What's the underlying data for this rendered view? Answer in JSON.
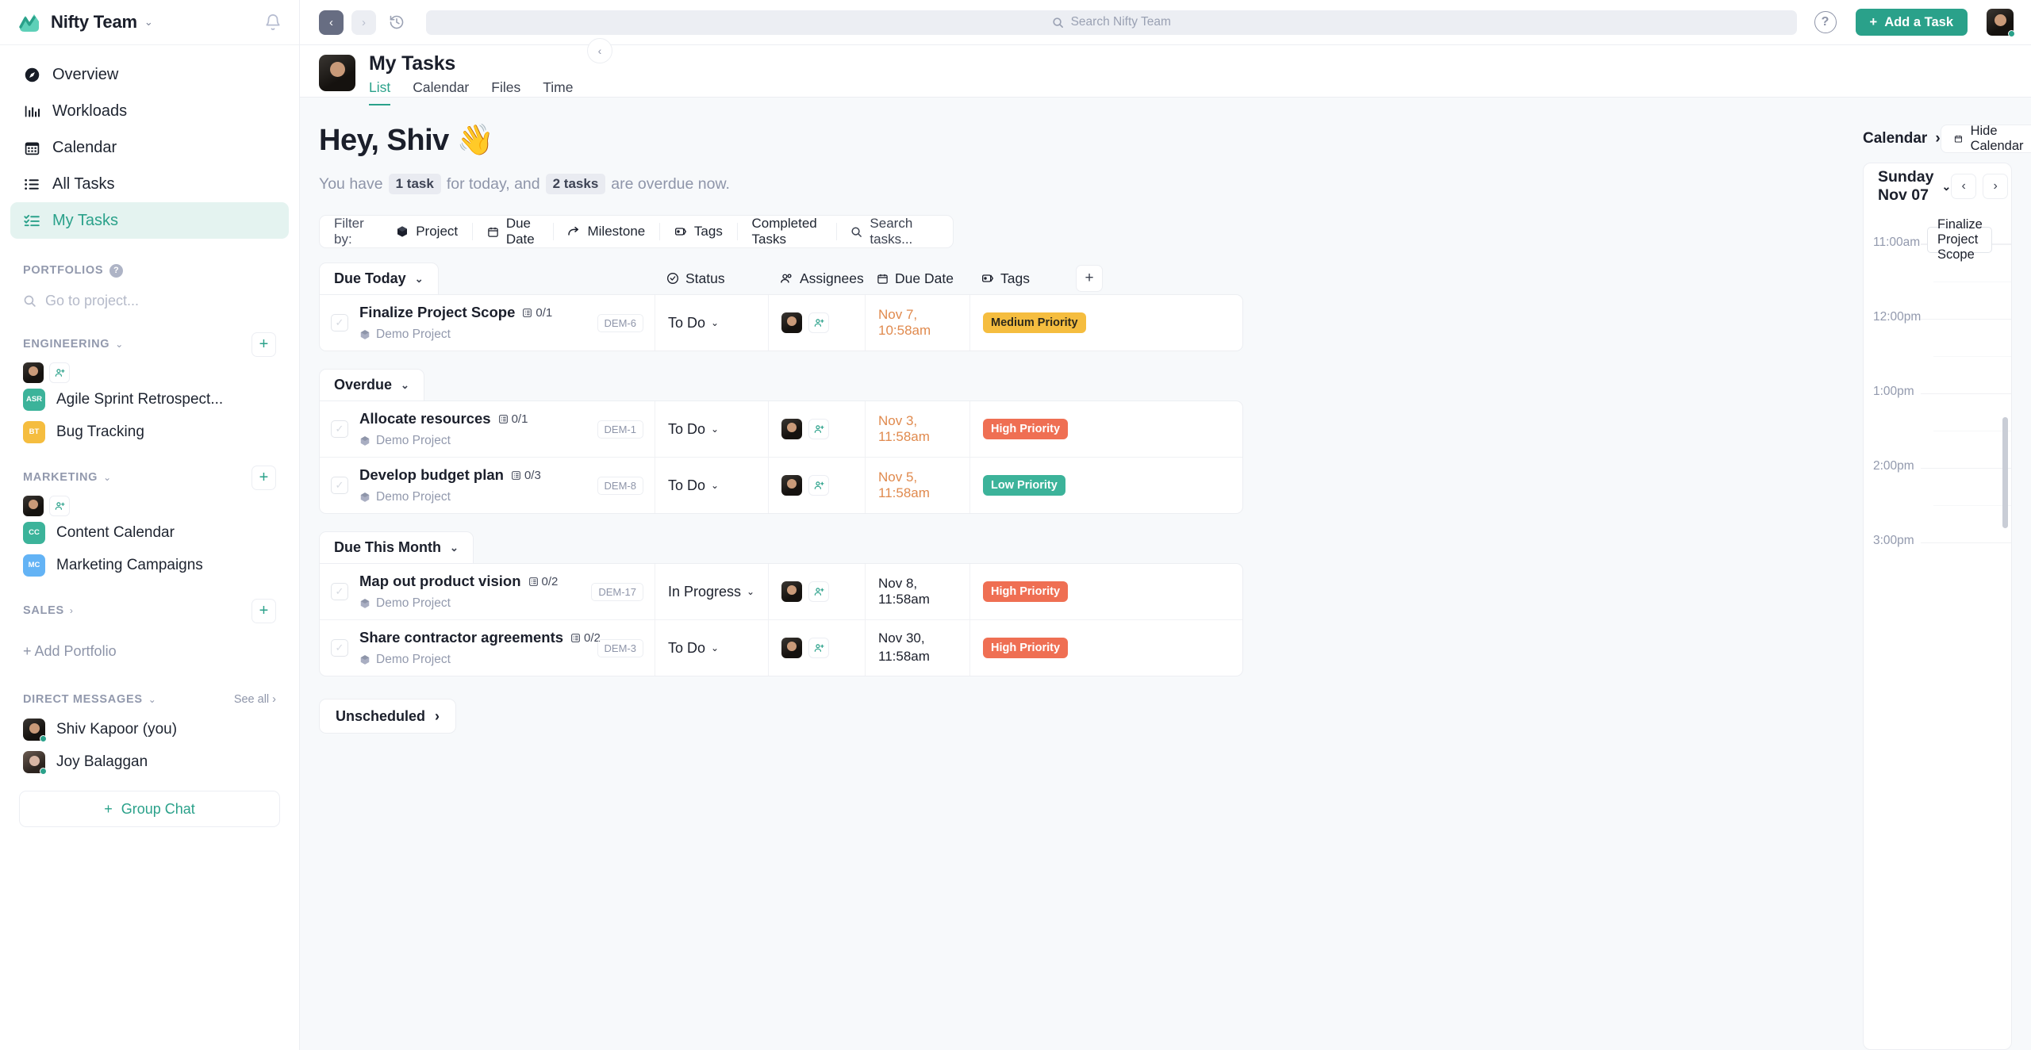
{
  "brand": {
    "name": "Nifty Team",
    "caret": "⌄"
  },
  "nav": [
    {
      "label": "Overview",
      "icon": "compass-icon",
      "active": false
    },
    {
      "label": "Workloads",
      "icon": "bar-chart-icon",
      "active": false
    },
    {
      "label": "Calendar",
      "icon": "calendar-icon",
      "active": false
    },
    {
      "label": "All Tasks",
      "icon": "list-icon",
      "active": false
    },
    {
      "label": "My Tasks",
      "icon": "checklist-icon",
      "active": true
    }
  ],
  "portfolios": {
    "title": "PORTFOLIOS",
    "search_placeholder": "Go to project...",
    "groups": [
      {
        "title": "ENGINEERING",
        "collapsed": false,
        "projects": [
          {
            "initials": "ASR",
            "name": "Agile Sprint Retrospect...",
            "color": "#3cb39a"
          },
          {
            "initials": "BT",
            "name": "Bug Tracking",
            "color": "#f5bd3f"
          }
        ]
      },
      {
        "title": "MARKETING",
        "collapsed": false,
        "projects": [
          {
            "initials": "CC",
            "name": "Content Calendar",
            "color": "#3cb39a"
          },
          {
            "initials": "MC",
            "name": "Marketing Campaigns",
            "color": "#63b3f5"
          }
        ]
      },
      {
        "title": "SALES",
        "collapsed": true,
        "projects": []
      }
    ],
    "add_label": "+ Add Portfolio"
  },
  "direct_messages": {
    "title": "DIRECT MESSAGES",
    "see_all": "See all",
    "people": [
      {
        "name": "Shiv Kapoor (you)",
        "online": true
      },
      {
        "name": "Joy Balaggan",
        "online": true
      }
    ],
    "group_chat": "Group Chat"
  },
  "topbar": {
    "back": "‹",
    "forward": "›",
    "history": "history-icon",
    "search_placeholder": "Search Nifty Team",
    "help": "?",
    "add_task": "Add a Task"
  },
  "page": {
    "title": "My Tasks",
    "tabs": [
      {
        "label": "List",
        "active": true
      },
      {
        "label": "Calendar",
        "active": false
      },
      {
        "label": "Files",
        "active": false
      },
      {
        "label": "Time",
        "active": false
      }
    ]
  },
  "greeting": {
    "heading": "Hey, Shiv 👋",
    "sub_pre": "You have",
    "today_chip": "1 task",
    "sub_mid": "for today, and",
    "overdue_chip": "2 tasks",
    "sub_post": "are overdue now."
  },
  "filters": {
    "label": "Filter by:",
    "items": [
      {
        "label": "Project",
        "icon": "cube-icon"
      },
      {
        "label": "Due Date",
        "icon": "calendar-icon"
      },
      {
        "label": "Milestone",
        "icon": "arrow-turn-icon"
      },
      {
        "label": "Tags",
        "icon": "tag-icon"
      },
      {
        "label": "Completed Tasks",
        "icon": ""
      },
      {
        "label": "Search tasks...",
        "icon": "search-icon"
      }
    ]
  },
  "table": {
    "columns": [
      {
        "label": "Status",
        "icon": "check-circle-icon"
      },
      {
        "label": "Assignees",
        "icon": "people-icon"
      },
      {
        "label": "Due Date",
        "icon": "calendar-icon"
      },
      {
        "label": "Tags",
        "icon": "tag-icon"
      }
    ],
    "add_column": "+",
    "groups": [
      {
        "name": "Due Today",
        "rows": [
          {
            "name": "Finalize Project Scope",
            "subtasks": "0/1",
            "code": "DEM-6",
            "project": "Demo Project",
            "status": "To Do",
            "due": "Nov 7, 10:58am",
            "due_overdue": true,
            "tag": "Medium Priority",
            "tag_kind": "med"
          }
        ]
      },
      {
        "name": "Overdue",
        "rows": [
          {
            "name": "Allocate resources",
            "subtasks": "0/1",
            "code": "DEM-1",
            "project": "Demo Project",
            "status": "To Do",
            "due": "Nov 3, 11:58am",
            "due_overdue": true,
            "tag": "High Priority",
            "tag_kind": "high"
          },
          {
            "name": "Develop budget plan",
            "subtasks": "0/3",
            "code": "DEM-8",
            "project": "Demo Project",
            "status": "To Do",
            "due": "Nov 5, 11:58am",
            "due_overdue": true,
            "tag": "Low Priority",
            "tag_kind": "low"
          }
        ]
      },
      {
        "name": "Due This Month",
        "rows": [
          {
            "name": "Map out product vision",
            "subtasks": "0/2",
            "code": "DEM-17",
            "project": "Demo Project",
            "status": "In Progress",
            "due": "Nov 8, 11:58am",
            "due_overdue": false,
            "tag": "High Priority",
            "tag_kind": "high"
          },
          {
            "name": "Share contractor agreements",
            "subtasks": "0/2",
            "code": "DEM-3",
            "project": "Demo Project",
            "status": "To Do",
            "due": "Nov 30, 11:58am",
            "due_overdue": false,
            "tag": "High Priority",
            "tag_kind": "high"
          }
        ]
      }
    ],
    "unscheduled": "Unscheduled"
  },
  "calendar": {
    "title": "Calendar",
    "hide_label": "Hide Calendar",
    "day_label": "Sunday Nov 07",
    "prev": "‹",
    "next": "›",
    "hours": [
      "11:00am",
      "12:00pm",
      "1:00pm",
      "2:00pm",
      "3:00pm"
    ],
    "events": [
      {
        "title": "Finalize Project Scope",
        "hour_index": 0
      }
    ]
  },
  "colors": {
    "accent": "#2aa18a",
    "overdue": "#e08a4e",
    "high": "#ef6f53",
    "medium": "#f5bd3f",
    "low": "#3cb39a"
  }
}
